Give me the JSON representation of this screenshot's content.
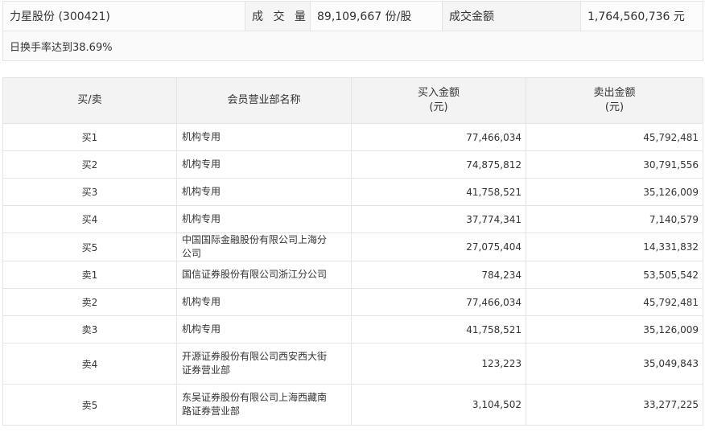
{
  "summary": {
    "stock": "力星股份 (300421)",
    "volume_label": "成 交 量",
    "volume_value": "89,109,667 份/股",
    "amount_label": "成交金额",
    "amount_value": "1,764,560,736 元",
    "reason": "日换手率达到38.69%"
  },
  "table": {
    "headers": {
      "side": "买/卖",
      "name": "会员营业部名称",
      "buy_line1": "买入金额",
      "buy_line2": "(元)",
      "sell_line1": "卖出金额",
      "sell_line2": "(元)"
    },
    "rows": [
      {
        "side": "买1",
        "name": "机构专用",
        "buy": "77,466,034",
        "sell": "45,792,481"
      },
      {
        "side": "买2",
        "name": "机构专用",
        "buy": "74,875,812",
        "sell": "30,791,556"
      },
      {
        "side": "买3",
        "name": "机构专用",
        "buy": "41,758,521",
        "sell": "35,126,009"
      },
      {
        "side": "买4",
        "name": "机构专用",
        "buy": "37,774,341",
        "sell": "7,140,579"
      },
      {
        "side": "买5",
        "name": "中国国际金融股份有限公司上海分公司",
        "buy": "27,075,404",
        "sell": "14,331,832"
      },
      {
        "side": "卖1",
        "name": "国信证券股份有限公司浙江分公司",
        "buy": "784,234",
        "sell": "53,505,542"
      },
      {
        "side": "卖2",
        "name": "机构专用",
        "buy": "77,466,034",
        "sell": "45,792,481"
      },
      {
        "side": "卖3",
        "name": "机构专用",
        "buy": "41,758,521",
        "sell": "35,126,009"
      },
      {
        "side": "卖4",
        "name": "开源证券股份有限公司西安西大街证券营业部",
        "buy": "123,223",
        "sell": "35,049,843"
      },
      {
        "side": "卖5",
        "name": "东吴证券股份有限公司上海西藏南路证券营业部",
        "buy": "3,104,502",
        "sell": "33,277,225"
      }
    ]
  }
}
